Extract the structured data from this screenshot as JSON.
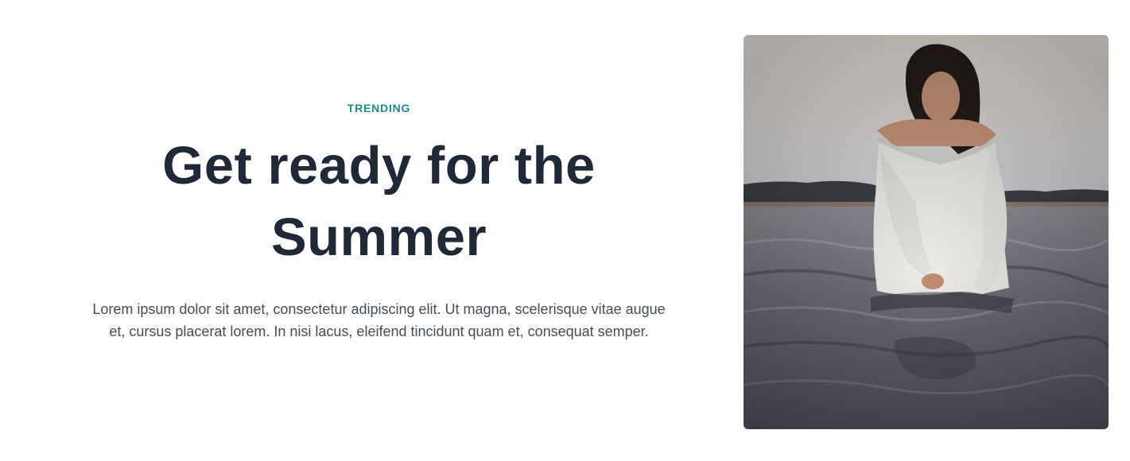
{
  "hero": {
    "eyebrow": "TRENDING",
    "headline_line1": "Get ready for the",
    "headline_line2": "Summer",
    "body": "Lorem ipsum dolor sit amet, consectetur adipiscing elit. Ut magna, scelerisque vitae augue et, cursus placerat lorem. In nisi lacus, eleifend tincidunt quam et, consequat semper."
  },
  "colors": {
    "accent": "#1f8a8f",
    "headline": "#1f2937",
    "body_text": "#434d5b"
  }
}
